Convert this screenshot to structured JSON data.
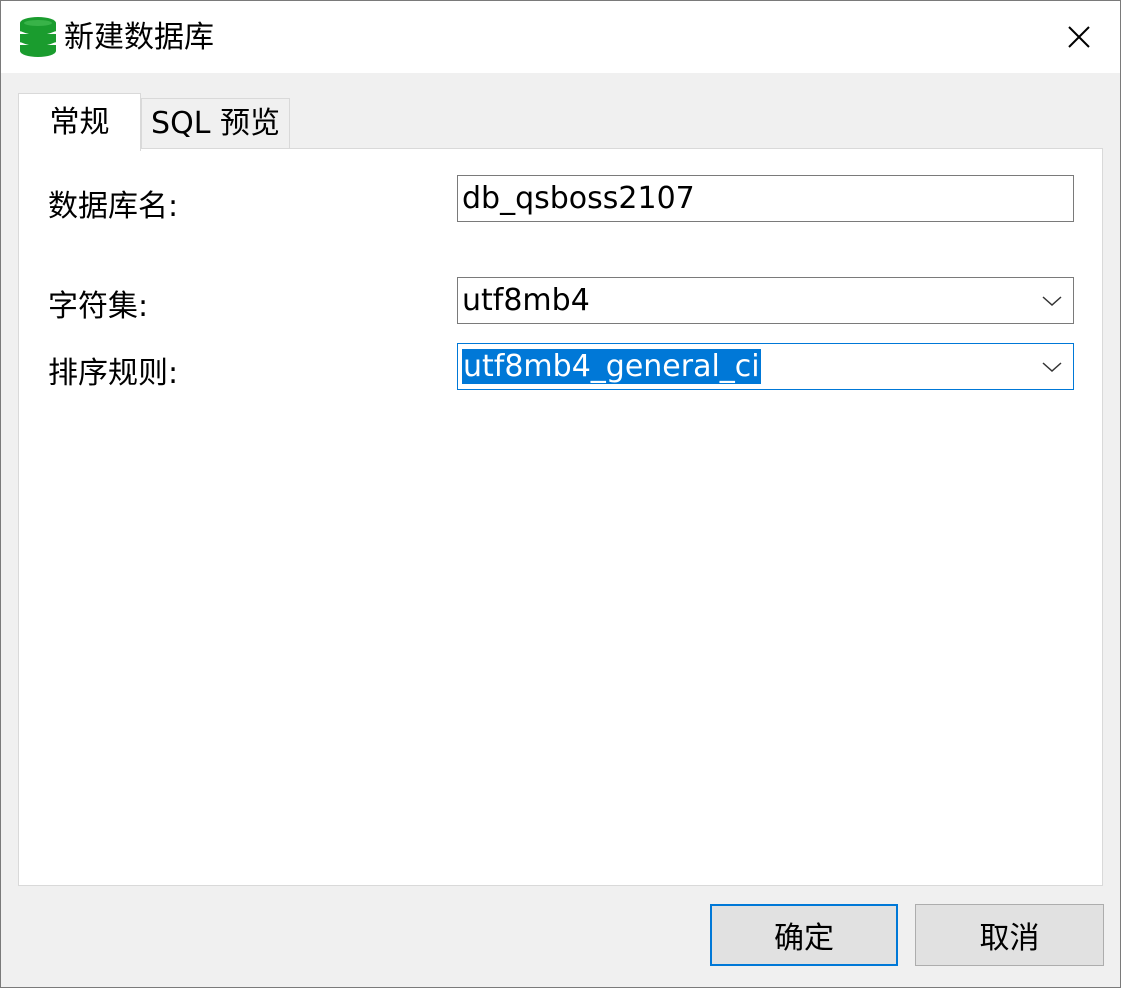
{
  "window": {
    "title": "新建数据库",
    "app_icon": "database-icon",
    "close_icon": "close-icon"
  },
  "tabs": [
    {
      "label": "常规",
      "active": true
    },
    {
      "label": "SQL 预览",
      "active": false
    }
  ],
  "form": {
    "database_name": {
      "label": "数据库名:",
      "value": "db_qsboss2107"
    },
    "charset": {
      "label": "字符集:",
      "value": "utf8mb4"
    },
    "collation": {
      "label": "排序规则:",
      "value": "utf8mb4_general_ci"
    }
  },
  "buttons": {
    "ok": "确定",
    "cancel": "取消"
  },
  "colors": {
    "accent": "#0078d7",
    "icon_green": "#1a9c2e"
  }
}
